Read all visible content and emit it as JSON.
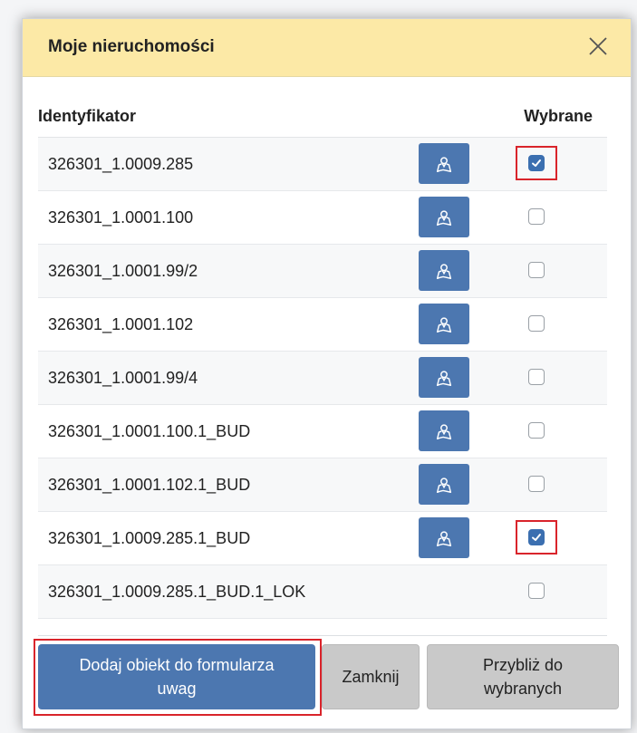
{
  "dialog": {
    "title": "Moje nieruchomości",
    "close_icon": "close-icon"
  },
  "table": {
    "headers": {
      "id": "Identyfikator",
      "selected": "Wybrane"
    },
    "rows": [
      {
        "id": "326301_1.0009.285",
        "has_map": true,
        "checked": true,
        "highlighted": true
      },
      {
        "id": "326301_1.0001.100",
        "has_map": true,
        "checked": false,
        "highlighted": false
      },
      {
        "id": "326301_1.0001.99/2",
        "has_map": true,
        "checked": false,
        "highlighted": false
      },
      {
        "id": "326301_1.0001.102",
        "has_map": true,
        "checked": false,
        "highlighted": false
      },
      {
        "id": "326301_1.0001.99/4",
        "has_map": true,
        "checked": false,
        "highlighted": false
      },
      {
        "id": "326301_1.0001.100.1_BUD",
        "has_map": true,
        "checked": false,
        "highlighted": false
      },
      {
        "id": "326301_1.0001.102.1_BUD",
        "has_map": true,
        "checked": false,
        "highlighted": false
      },
      {
        "id": "326301_1.0009.285.1_BUD",
        "has_map": true,
        "checked": true,
        "highlighted": true
      },
      {
        "id": "326301_1.0009.285.1_BUD.1_LOK",
        "has_map": false,
        "checked": false,
        "highlighted": false
      }
    ]
  },
  "footer": {
    "add_label_line1": "Dodaj obiekt do formularza",
    "add_label_line2": "uwag",
    "close_label": "Zamknij",
    "zoom_label_line1": "Przybliż do",
    "zoom_label_line2": "wybranych"
  },
  "colors": {
    "header_bg": "#fce9a6",
    "primary": "#4c77b0",
    "highlight": "#d9242b"
  }
}
